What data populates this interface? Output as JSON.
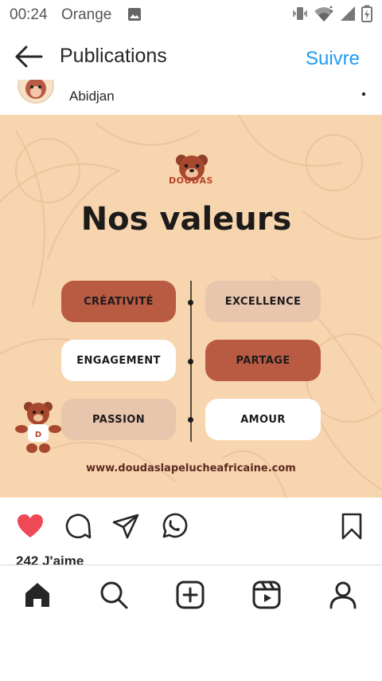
{
  "status_bar": {
    "time": "00:24",
    "carrier": "Orange"
  },
  "header": {
    "title": "Publications",
    "follow_label": "Suivre"
  },
  "post": {
    "location": "Abidjan",
    "image": {
      "brand_name": "DOUDAS",
      "headline": "Nos valeurs",
      "values_left": [
        "CRÉATIVITÉ",
        "ENGAGEMENT",
        "PASSION"
      ],
      "values_right": [
        "EXCELLENCE",
        "PARTAGE",
        "AMOUR"
      ],
      "website": "www.doudaslapelucheafricaine.com",
      "colors": {
        "background": "#f7d5ae",
        "rust": "#b95a43",
        "beige": "#e8c5ad",
        "white": "#ffffff"
      }
    },
    "likes_text": "242 J'aime",
    "liked": true
  },
  "actions": {
    "like_icon": "heart-icon",
    "comment_icon": "comment-icon",
    "share_icon": "send-icon",
    "whatsapp_icon": "whatsapp-icon",
    "save_icon": "bookmark-icon"
  },
  "bottom_nav": {
    "items": [
      "home-icon",
      "search-icon",
      "create-icon",
      "reels-icon",
      "profile-icon"
    ]
  },
  "colors": {
    "accent": "#1d9bf0",
    "like": "#ed4956"
  }
}
